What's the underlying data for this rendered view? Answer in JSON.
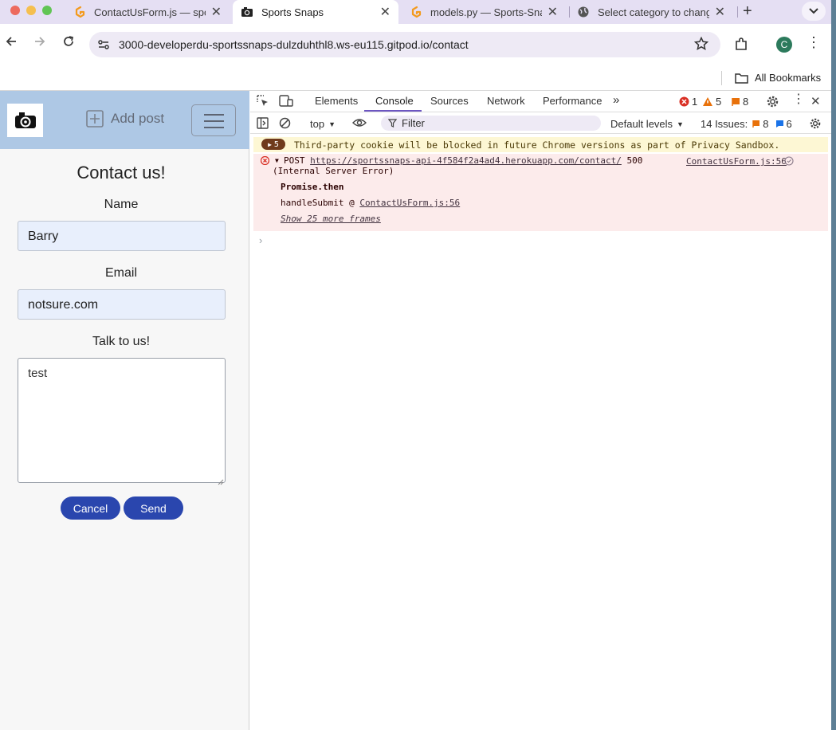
{
  "tabs": [
    {
      "title": "ContactUsForm.js — spo",
      "icon": "gitpod-icon"
    },
    {
      "title": "Sports Snaps",
      "icon": "camera-icon",
      "active": true
    },
    {
      "title": "models.py — Sports-Sna",
      "icon": "gitpod-icon"
    },
    {
      "title": "Select category to chang",
      "icon": "globe-icon"
    }
  ],
  "toolbar": {
    "url": "3000-developerdu-sportssnaps-dulzduhthl8.ws-eu115.gitpod.io/contact",
    "profile_initial": "C"
  },
  "bookmarks": {
    "all_bookmarks_label": "All Bookmarks"
  },
  "page": {
    "add_post_label": "Add post",
    "form_title": "Contact us!",
    "name_label": "Name",
    "name_value": "Barry",
    "email_label": "Email",
    "email_value": "notsure.com",
    "message_label": "Talk to us!",
    "message_value": "test",
    "cancel_label": "Cancel",
    "send_label": "Send"
  },
  "devtools": {
    "tabs": [
      "Elements",
      "Console",
      "Sources",
      "Network",
      "Performance"
    ],
    "active_tab": "Console",
    "counts": {
      "errors": "1",
      "warnings": "5",
      "issues": "8"
    },
    "context": "top",
    "filter_placeholder": "Filter",
    "levels": "Default levels",
    "issues_label": "14 Issues:",
    "issues_a": "8",
    "issues_b": "6",
    "warning": {
      "count": "5",
      "text": "Third-party cookie will be blocked in future Chrome versions as part of Privacy Sandbox."
    },
    "error": {
      "method": "POST",
      "url": "https://sportssnaps-api-4f584f2a4ad4.herokuapp.com/contact/",
      "status": "500",
      "status_text": "(Internal Server Error)",
      "source": "ContactUsForm.js:56",
      "promise": "Promise.then",
      "frame_fn": "handleSubmit @",
      "frame_src": "ContactUsForm.js:56",
      "more_frames": "Show 25 more frames"
    }
  }
}
